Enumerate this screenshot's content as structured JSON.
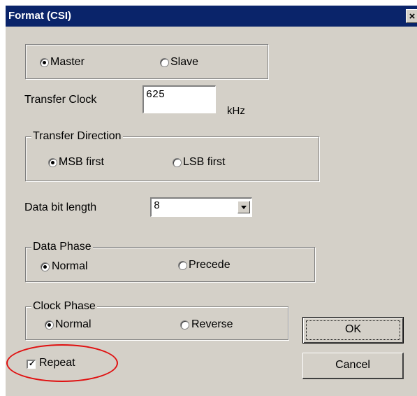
{
  "dialog": {
    "title": "Format (CSI)",
    "close_label": "×"
  },
  "mode": {
    "master_label": "Master",
    "slave_label": "Slave",
    "selected": "Master"
  },
  "transfer_clock": {
    "label": "Transfer Clock",
    "value": "625",
    "unit": "kHz"
  },
  "transfer_direction": {
    "legend": "Transfer Direction",
    "msb_label": "MSB first",
    "lsb_label": "LSB first",
    "selected": "MSB first"
  },
  "data_bit_length": {
    "label": "Data bit length",
    "value": "8"
  },
  "data_phase": {
    "legend": "Data Phase",
    "normal_label": "Normal",
    "precede_label": "Precede",
    "selected": "Normal"
  },
  "clock_phase": {
    "legend": "Clock Phase",
    "normal_label": "Normal",
    "reverse_label": "Reverse",
    "selected": "Normal"
  },
  "repeat": {
    "label": "Repeat",
    "checked": true,
    "check_glyph": "✓"
  },
  "buttons": {
    "ok_label": "OK",
    "cancel_label": "Cancel"
  },
  "annotation": {
    "highlight_color": "#e01010"
  }
}
